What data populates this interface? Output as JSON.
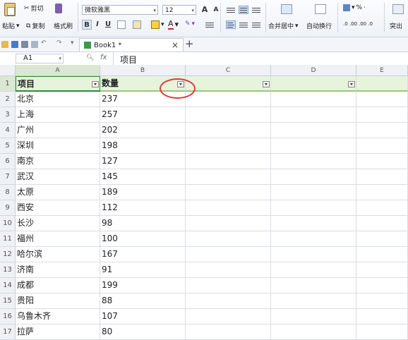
{
  "toolbar": {
    "paste": "粘贴",
    "cut": "剪切",
    "copy": "复制",
    "format_painter": "格式刷",
    "font_name": "微软雅黑",
    "font_size": "12",
    "bold": "B",
    "italic": "I",
    "underline": "U",
    "font_grow": "A",
    "font_shrink": "A",
    "font_color_letter": "A",
    "merge_center": "合并居中",
    "wrap_text": "自动换行",
    "percent": "%",
    "highlight": "突出",
    "dec_increase": ".0 .00",
    "dec_decrease": ".00 .0"
  },
  "tabs": {
    "book_title": "Book1 *",
    "close": "×",
    "add": "+"
  },
  "formula_bar": {
    "name_box": "A1",
    "fx": "fx",
    "content": "项目"
  },
  "columns": [
    "A",
    "B",
    "C",
    "D",
    "E"
  ],
  "header_row": {
    "row": "1",
    "a": "项目",
    "b": "数量"
  },
  "rows": [
    {
      "row": "2",
      "city": "北京",
      "qty": "237"
    },
    {
      "row": "3",
      "city": "上海",
      "qty": "257"
    },
    {
      "row": "4",
      "city": "广州",
      "qty": "202"
    },
    {
      "row": "5",
      "city": "深圳",
      "qty": "198"
    },
    {
      "row": "6",
      "city": "南京",
      "qty": "127"
    },
    {
      "row": "7",
      "city": "武汉",
      "qty": "145"
    },
    {
      "row": "8",
      "city": "太原",
      "qty": "189"
    },
    {
      "row": "9",
      "city": "西安",
      "qty": "112"
    },
    {
      "row": "10",
      "city": "长沙",
      "qty": "98"
    },
    {
      "row": "11",
      "city": "福州",
      "qty": "100"
    },
    {
      "row": "12",
      "city": "哈尔滨",
      "qty": "167"
    },
    {
      "row": "13",
      "city": "济南",
      "qty": "91"
    },
    {
      "row": "14",
      "city": "成都",
      "qty": "199"
    },
    {
      "row": "15",
      "city": "贵阳",
      "qty": "88"
    },
    {
      "row": "16",
      "city": "乌鲁木齐",
      "qty": "107"
    },
    {
      "row": "17",
      "city": "拉萨",
      "qty": "80"
    }
  ],
  "colors": {
    "header_fill": "#e6f4dc",
    "annotation": "#e03a3a"
  }
}
